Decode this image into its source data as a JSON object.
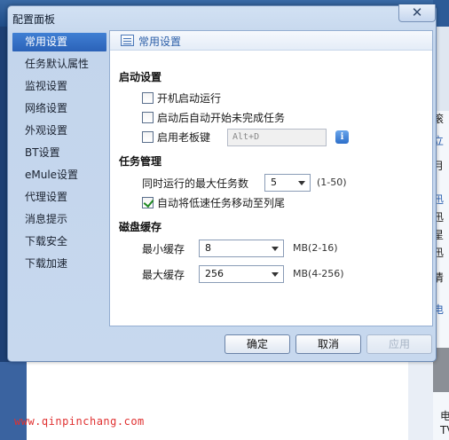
{
  "dialog": {
    "title": "配置面板",
    "close_glyph": "✕"
  },
  "sidebar": {
    "items": [
      {
        "label": "常用设置",
        "active": true
      },
      {
        "label": "任务默认属性"
      },
      {
        "label": "监视设置"
      },
      {
        "label": "网络设置"
      },
      {
        "label": "外观设置"
      },
      {
        "label": "BT设置"
      },
      {
        "label": "eMule设置"
      },
      {
        "label": "代理设置"
      },
      {
        "label": "消息提示"
      },
      {
        "label": "下载安全"
      },
      {
        "label": "下载加速"
      }
    ]
  },
  "content": {
    "header_title": "常用设置",
    "startup": {
      "title": "启动设置",
      "run_on_boot": {
        "label": "开机启动运行",
        "checked": false
      },
      "auto_start_tasks": {
        "label": "启动后自动开始未完成任务",
        "checked": false
      },
      "boss_key": {
        "label": "启用老板键",
        "checked": false,
        "value": "Alt+D"
      }
    },
    "tasks": {
      "title": "任务管理",
      "max_tasks_label": "同时运行的最大任务数",
      "max_tasks_value": "5",
      "max_tasks_range": "(1-50)",
      "auto_move_slow": {
        "label": "自动将低速任务移动至列尾",
        "checked": true
      }
    },
    "cache": {
      "title": "磁盘缓存",
      "min_label": "最小缓存",
      "min_value": "8",
      "min_range": "MB(2-16)",
      "max_label": "最大缓存",
      "max_value": "256",
      "max_range": "MB(4-256)"
    }
  },
  "buttons": {
    "ok": "确定",
    "cancel": "取消",
    "apply": "应用"
  },
  "background": {
    "watermark": "www.qinpinchang.com",
    "right_texts": [
      "滚",
      "立",
      "月",
      "迅",
      "迅",
      "星",
      "迅",
      "清",
      "电"
    ],
    "bottom_texts": [
      "电",
      "TV"
    ]
  },
  "colors": {
    "accent": "#2b62b8",
    "watermark": "#e03030"
  }
}
